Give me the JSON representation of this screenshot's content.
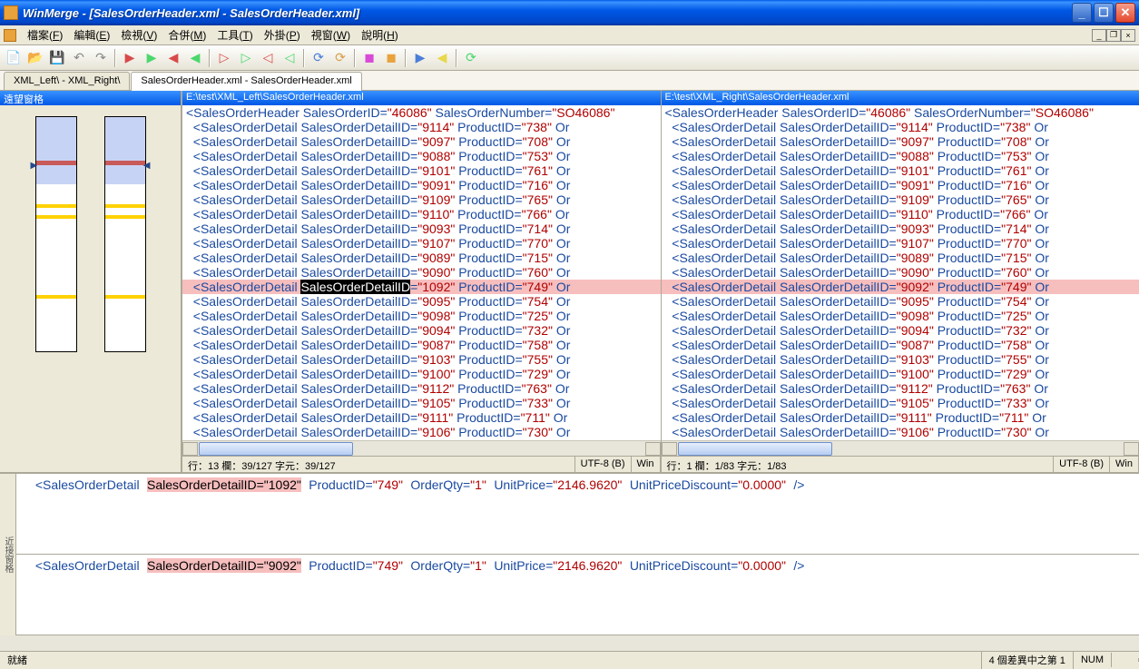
{
  "title": "WinMerge - [SalesOrderHeader.xml - SalesOrderHeader.xml]",
  "menu": [
    "檔案(F)",
    "編輯(E)",
    "檢視(V)",
    "合併(M)",
    "工具(T)",
    "外掛(P)",
    "視窗(W)",
    "說明(H)"
  ],
  "locpane_title": "遠望窗格",
  "tabs": [
    {
      "label": "XML_Left\\ - XML_Right\\",
      "active": false
    },
    {
      "label": "SalesOrderHeader.xml - SalesOrderHeader.xml",
      "active": true
    }
  ],
  "left": {
    "path": "E:\\test\\XML_Left\\SalesOrderHeader.xml",
    "header_line": {
      "tag": "SalesOrderHeader",
      "attrs": [
        [
          "SalesOrderID",
          "46086"
        ],
        [
          "SalesOrderNumber",
          "SO46086"
        ]
      ]
    },
    "rows": [
      {
        "id": "9114",
        "pid": "738"
      },
      {
        "id": "9097",
        "pid": "708"
      },
      {
        "id": "9088",
        "pid": "753"
      },
      {
        "id": "9101",
        "pid": "761"
      },
      {
        "id": "9091",
        "pid": "716"
      },
      {
        "id": "9109",
        "pid": "765"
      },
      {
        "id": "9110",
        "pid": "766"
      },
      {
        "id": "9093",
        "pid": "714"
      },
      {
        "id": "9107",
        "pid": "770"
      },
      {
        "id": "9089",
        "pid": "715"
      },
      {
        "id": "9090",
        "pid": "760"
      },
      {
        "id": "1092",
        "pid": "749",
        "diff": true,
        "seltok": true
      },
      {
        "id": "9095",
        "pid": "754"
      },
      {
        "id": "9098",
        "pid": "725"
      },
      {
        "id": "9094",
        "pid": "732"
      },
      {
        "id": "9087",
        "pid": "758"
      },
      {
        "id": "9103",
        "pid": "755"
      },
      {
        "id": "9100",
        "pid": "729"
      },
      {
        "id": "9112",
        "pid": "763"
      },
      {
        "id": "9105",
        "pid": "733"
      },
      {
        "id": "9111",
        "pid": "711"
      },
      {
        "id": "9106",
        "pid": "730"
      }
    ],
    "status": {
      "pos": "行：13 欄：39/127 字元：39/127",
      "enc": "UTF-8 (B)",
      "eol": "Win"
    }
  },
  "right": {
    "path": "E:\\test\\XML_Right\\SalesOrderHeader.xml",
    "header_line": {
      "tag": "SalesOrderHeader",
      "attrs": [
        [
          "SalesOrderID",
          "46086"
        ],
        [
          "SalesOrderNumber",
          "SO46086"
        ]
      ]
    },
    "rows": [
      {
        "id": "9114",
        "pid": "738"
      },
      {
        "id": "9097",
        "pid": "708"
      },
      {
        "id": "9088",
        "pid": "753"
      },
      {
        "id": "9101",
        "pid": "761"
      },
      {
        "id": "9091",
        "pid": "716"
      },
      {
        "id": "9109",
        "pid": "765"
      },
      {
        "id": "9110",
        "pid": "766"
      },
      {
        "id": "9093",
        "pid": "714"
      },
      {
        "id": "9107",
        "pid": "770"
      },
      {
        "id": "9089",
        "pid": "715"
      },
      {
        "id": "9090",
        "pid": "760"
      },
      {
        "id": "9092",
        "pid": "749",
        "diff": true
      },
      {
        "id": "9095",
        "pid": "754"
      },
      {
        "id": "9098",
        "pid": "725"
      },
      {
        "id": "9094",
        "pid": "732"
      },
      {
        "id": "9087",
        "pid": "758"
      },
      {
        "id": "9103",
        "pid": "755"
      },
      {
        "id": "9100",
        "pid": "729"
      },
      {
        "id": "9112",
        "pid": "763"
      },
      {
        "id": "9105",
        "pid": "733"
      },
      {
        "id": "9111",
        "pid": "711"
      },
      {
        "id": "9106",
        "pid": "730"
      }
    ],
    "status": {
      "pos": "行：1 欄：1/83 字元：1/83",
      "enc": "UTF-8 (B)",
      "eol": "Win"
    }
  },
  "detail": {
    "a": {
      "tag": "SalesOrderDetail",
      "hl": "SalesOrderDetailID=\"1092\"",
      "rest": [
        [
          "ProductID",
          "749"
        ],
        [
          "OrderQty",
          "1"
        ],
        [
          "UnitPrice",
          "2146.9620"
        ],
        [
          "UnitPriceDiscount",
          "0.0000"
        ]
      ]
    },
    "b": {
      "tag": "SalesOrderDetail",
      "hl": "SalesOrderDetailID=\"9092\"",
      "rest": [
        [
          "ProductID",
          "749"
        ],
        [
          "OrderQty",
          "1"
        ],
        [
          "UnitPrice",
          "2146.9620"
        ],
        [
          "UnitPriceDiscount",
          "0.0000"
        ]
      ]
    },
    "gutter": "近接窗格"
  },
  "statusbar": {
    "ready": "就緒",
    "diff_pos": "4 個差異中之第 1",
    "num": "NUM"
  },
  "toolbar_icons": [
    "📄",
    "📂",
    "💾",
    "↶",
    "↷",
    "|",
    "▶",
    "▶",
    "◀",
    "◀",
    "|",
    "▷",
    "▷",
    "◁",
    "◁",
    "|",
    "⟳",
    "⟳",
    "|",
    "◼",
    "◼",
    "|",
    "▶",
    "◀",
    "|",
    "⟳"
  ]
}
